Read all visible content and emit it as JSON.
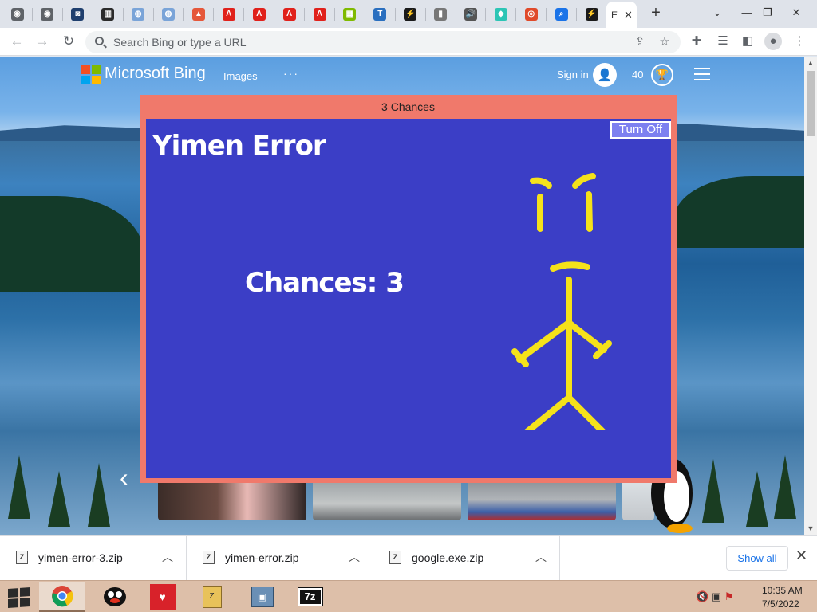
{
  "browser": {
    "tabs": [
      {
        "icon": "globe-icon",
        "color": "#5f6368",
        "glyph": "◉"
      },
      {
        "icon": "globe-icon",
        "color": "#5f6368",
        "glyph": "◉"
      },
      {
        "icon": "archive-icon",
        "color": "#1f3f6e",
        "glyph": "◙"
      },
      {
        "icon": "library-icon",
        "color": "#2b2b2b",
        "glyph": "▥"
      },
      {
        "icon": "wiki-icon",
        "color": "#7aa4d8",
        "glyph": "◍"
      },
      {
        "icon": "wiki-icon",
        "color": "#7aa4d8",
        "glyph": "◍"
      },
      {
        "icon": "colorful-icon",
        "color": "#e5573a",
        "glyph": "▲"
      },
      {
        "icon": "adobe-icon",
        "color": "#e0211b",
        "glyph": "A"
      },
      {
        "icon": "adobe-icon",
        "color": "#e0211b",
        "glyph": "A"
      },
      {
        "icon": "adobe-icon",
        "color": "#e0211b",
        "glyph": "A"
      },
      {
        "icon": "adobe-icon",
        "color": "#e0211b",
        "glyph": "A"
      },
      {
        "icon": "microsoft-icon",
        "color": "#7fba00",
        "glyph": "▦"
      },
      {
        "icon": "tw-icon",
        "color": "#2a6fbf",
        "glyph": "T"
      },
      {
        "icon": "bolt-icon",
        "color": "#1a1a1a",
        "glyph": "⚡"
      },
      {
        "icon": "media-icon",
        "color": "#777",
        "glyph": "▮"
      },
      {
        "icon": "audio-icon",
        "color": "#555",
        "glyph": "🔊"
      },
      {
        "icon": "teal-icon",
        "color": "#2cc5b5",
        "glyph": "◆"
      },
      {
        "icon": "red-ring-icon",
        "color": "#e04a2a",
        "glyph": "◎"
      },
      {
        "icon": "search-icon",
        "color": "#1a73e8",
        "glyph": "⌕"
      },
      {
        "icon": "bolt-icon",
        "color": "#1a1a1a",
        "glyph": "⚡"
      }
    ],
    "active_tab": {
      "letter": "E",
      "close": "✕"
    },
    "new_tab": "+",
    "window_buttons": {
      "dropdown": "⌄",
      "minimize": "—",
      "restore": "❐",
      "close": "✕"
    },
    "omnibox_placeholder": "Search Bing or type a URL"
  },
  "bing": {
    "brand": "Microsoft Bing",
    "logo_colors": [
      "#f25022",
      "#7fba00",
      "#00a4ef",
      "#ffb900"
    ],
    "nav": {
      "images": "Images",
      "more": "···"
    },
    "sign_in": "Sign in",
    "points": "40"
  },
  "popup": {
    "title": "3 Chances",
    "turn_off": "Turn Off",
    "heading": "Yimen Error",
    "chances": "Chances: 3",
    "colors": {
      "frame": "#f0796b",
      "body": "#3b3ec6",
      "stickman": "#f5e21a"
    }
  },
  "downloads": {
    "items": [
      {
        "name": "yimen-error-3.zip"
      },
      {
        "name": "yimen-error.zip"
      },
      {
        "name": "google.exe.zip"
      }
    ],
    "show_all": "Show all"
  },
  "taskbar": {
    "apps": [
      {
        "name": "chrome",
        "active": true
      },
      {
        "name": "pingu",
        "active": false
      },
      {
        "name": "algida",
        "active": false
      },
      {
        "name": "zip-archive",
        "active": false
      },
      {
        "name": "installer",
        "active": false
      },
      {
        "name": "7zip",
        "active": false
      }
    ],
    "clock": {
      "time": "10:35 AM",
      "date": "7/5/2022"
    }
  }
}
